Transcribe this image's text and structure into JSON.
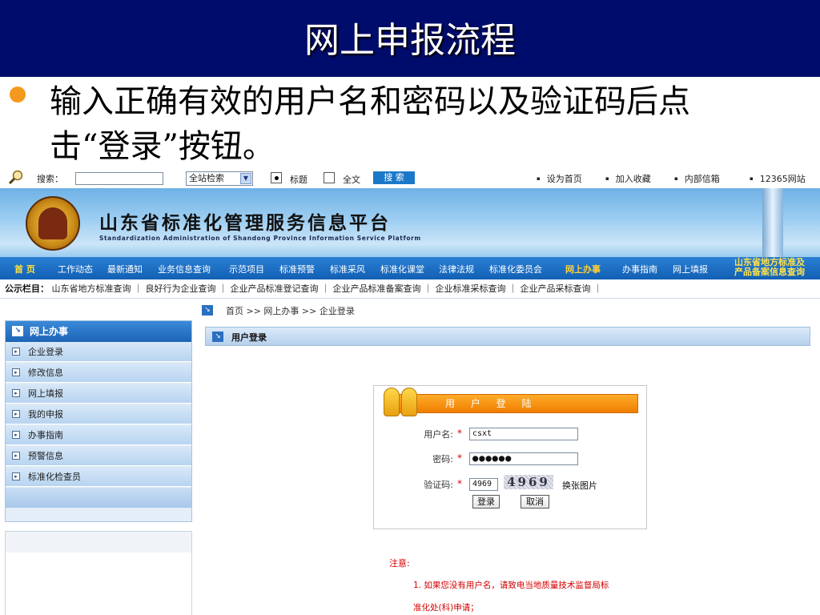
{
  "slide": {
    "title": "网上申报流程",
    "bullet_line1": "输入正确有效的用户名和密码以及验证码后点",
    "bullet_line2": "击“登录”按钮。",
    "accent_colors": {
      "title_bar": "#000c6b",
      "bullet": "#f39a1d"
    }
  },
  "top_bar": {
    "search_label": "搜索：",
    "search_value": "",
    "scope_select": "全站检索",
    "radio_title": "标题",
    "radio_fulltext": "全文",
    "search_button": "搜 索",
    "links": [
      "设为首页",
      "加入收藏",
      "内部信箱",
      "12365网站"
    ]
  },
  "banner": {
    "title": "山东省标准化管理服务信息平台",
    "subtitle": "Standardization Administration of Shandong Province Information Service Platform"
  },
  "nav": {
    "home": "首 页",
    "items": [
      "工作动态",
      "最新通知",
      "业务信息查询",
      "示范项目",
      "标准预警",
      "标准采风",
      "标准化课堂",
      "法律法规",
      "标准化委员会"
    ],
    "online_service": "网上办事",
    "items_right": [
      "办事指南",
      "网上填报"
    ],
    "badge_line1": "山东省地方标准及",
    "badge_line2": "产品备案信息查询"
  },
  "notice": {
    "label": "公示栏目：",
    "text": "山东省地方标准查询 ｜ 良好行为企业查询 ｜ 企业产品标准登记查询 ｜ 企业产品标准备案查询 ｜ 企业标准采标查询 ｜ 企业产品采标查询 ｜"
  },
  "breadcrumb": "首页  >> 网上办事  >> 企业登录",
  "sidebar": {
    "title": "网上办事",
    "items": [
      "企业登录",
      "修改信息",
      "网上填报",
      "我的申报",
      "办事指南",
      "预警信息",
      "标准化检查员"
    ]
  },
  "main": {
    "header": "用户登录",
    "login": {
      "title": "用 户 登 陆",
      "username_label": "用户名:",
      "username_value": "csxt",
      "password_label": "密码:",
      "password_value": "●●●●●●",
      "captcha_label": "验证码:",
      "captcha_value": "4969",
      "captcha_image_text": "4969",
      "refresh_label": "换张图片",
      "submit_label": "登录",
      "cancel_label": "取消",
      "required_mark": "*"
    },
    "note": {
      "title": "注意:",
      "line1": "1. 如果您没有用户名，请致电当地质量技术监督局标",
      "line2": "准化处(科)申请；"
    }
  }
}
